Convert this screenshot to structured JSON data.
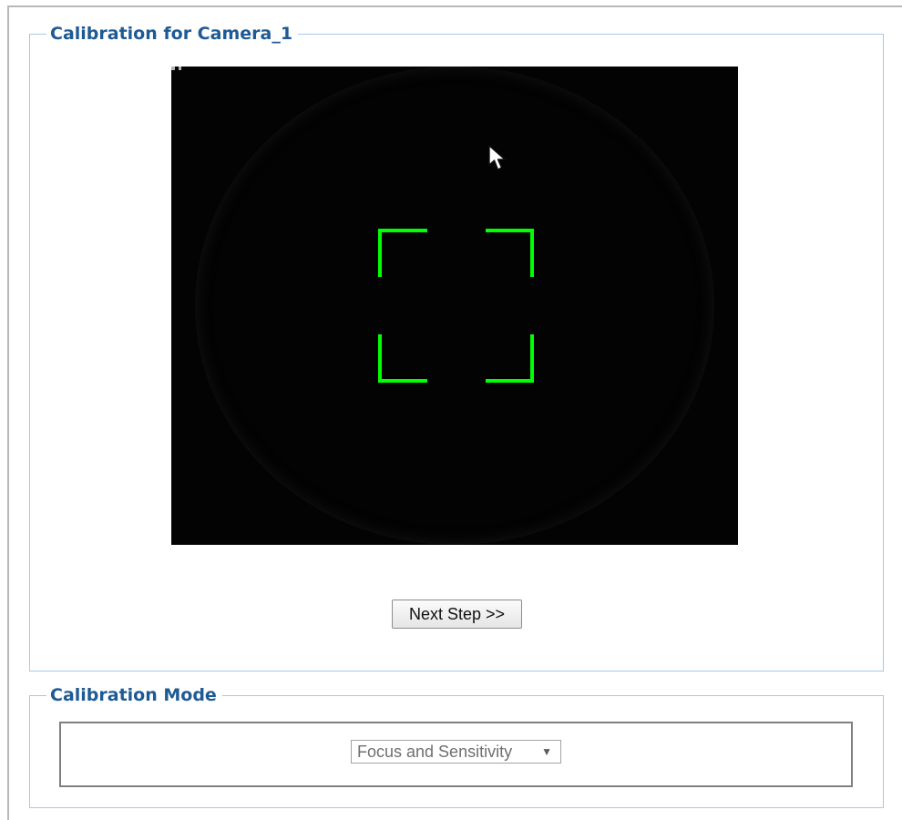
{
  "calibration_panel": {
    "title": "Calibration for Camera_1",
    "camera_feed": {
      "overlay_icon": "green-focus-brackets-icon",
      "cursor_icon": "mouse-pointer-icon",
      "overlay_color": "#00ff00",
      "background_color": "#030303"
    },
    "next_step_label": "Next Step >>"
  },
  "mode_panel": {
    "title": "Calibration Mode",
    "selected_mode": "Focus and Sensitivity",
    "dropdown_icon": "triangle-down-icon"
  },
  "colors": {
    "legend_text": "#1f5a94",
    "group_border": "#a9c8e8",
    "button_border": "#8d8d8d"
  }
}
